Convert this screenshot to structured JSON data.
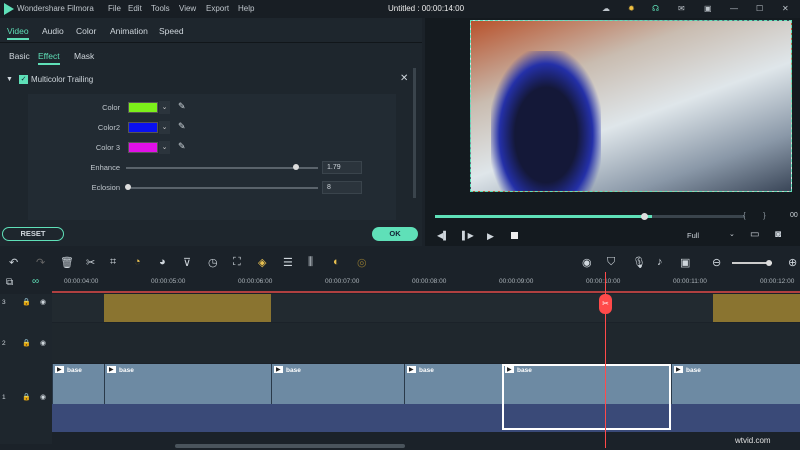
{
  "app": {
    "name": "Wondershare Filmora",
    "title": "Untitled : 00:00:14:00",
    "menu": [
      "File",
      "Edit",
      "Tools",
      "View",
      "Export",
      "Help"
    ]
  },
  "panel": {
    "tabs": [
      "Video",
      "Audio",
      "Color",
      "Animation",
      "Speed"
    ],
    "active_tab": "Video",
    "subtabs": [
      "Basic",
      "Effect",
      "Mask"
    ],
    "active_subtab": "Effect",
    "effect": {
      "name": "Multicolor Trailing",
      "enabled": true,
      "colors": [
        {
          "label": "Color",
          "value": "#7cf01a"
        },
        {
          "label": "Color2",
          "value": "#0a10f0"
        },
        {
          "label": "Color 3",
          "value": "#e010e8"
        }
      ],
      "sliders": [
        {
          "label": "Enhance",
          "value": "1.79",
          "fraction": 0.93
        },
        {
          "label": "Eclosion",
          "value": "8",
          "fraction": 0.0
        }
      ]
    },
    "reset_label": "RESET",
    "ok_label": "OK"
  },
  "preview": {
    "progress": 0.7,
    "quality": "Full",
    "time_partial": "00"
  },
  "timeline": {
    "ruler": [
      "00:00:04:00",
      "00:00:05:00",
      "00:00:06:00",
      "00:00:07:00",
      "00:00:08:00",
      "00:00:09:00",
      "00:00:10:00",
      "00:00:11:00",
      "00:00:12:00"
    ],
    "tracks": [
      "3",
      "2",
      "1"
    ],
    "clip_label": "base",
    "accent": "#5fe0b8",
    "playhead_color": "#ff4a4a",
    "effect_clip_color": "#8a7430"
  },
  "watermark": "wtvid.com"
}
